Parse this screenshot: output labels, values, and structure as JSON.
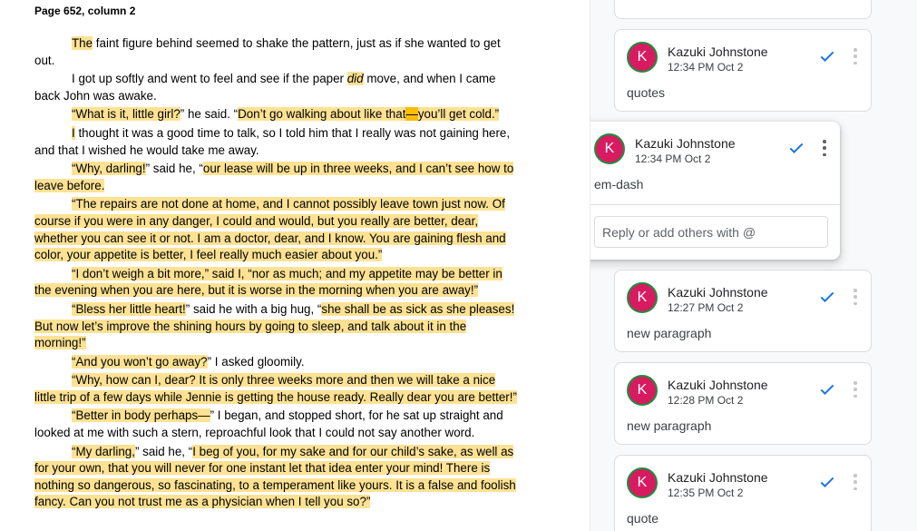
{
  "document": {
    "page_heading": "Page 652, column 2",
    "paragraphs": [
      {
        "segments": [
          {
            "text": "The",
            "style": "hl"
          },
          {
            "text": " faint figure behind seemed to shake the pattern, just as if she wanted to get out.",
            "style": ""
          }
        ]
      },
      {
        "segments": [
          {
            "text": "I got up softly and went to feel and see if the paper ",
            "style": ""
          },
          {
            "text": "did",
            "style": "hl-em"
          },
          {
            "text": " move, and when I came back John was awake.",
            "style": ""
          }
        ]
      },
      {
        "segments": [
          {
            "text": "“What is it, little girl?",
            "style": "hl"
          },
          {
            "text": "” he said. “",
            "style": ""
          },
          {
            "text": "Don’t go walking about like that",
            "style": "hl"
          },
          {
            "text": "—",
            "style": "hl-strong"
          },
          {
            "text": "you’ll get cold.”",
            "style": "hl"
          }
        ]
      },
      {
        "segments": [
          {
            "text": "I",
            "style": "hl"
          },
          {
            "text": " thought it was a good time to talk, so I told him that I really was not gaining here, and that I wished he would take me away.",
            "style": ""
          }
        ]
      },
      {
        "segments": [
          {
            "text": "“Why, darling!",
            "style": "hl"
          },
          {
            "text": "” said he, “",
            "style": ""
          },
          {
            "text": "our lease will be up in three weeks, and I can’t see how to leave before.",
            "style": "hl"
          }
        ]
      },
      {
        "segments": [
          {
            "text": "“The repairs are not done at home, and I cannot possibly leave town just now. Of course if you were in any danger, I could and would, but you really are better, dear, whether you can see it or not. I am a doctor, dear, and I know. You are gaining flesh and color, your appetite is better, I feel really much easier about you.”",
            "style": "hl"
          }
        ]
      },
      {
        "segments": [
          {
            "text": "“I don’t weigh a bit more,” said I, “nor as much; and my appetite may be better in the evening when you are here, but it is worse in the morning when you are away!”",
            "style": "hl"
          }
        ]
      },
      {
        "segments": [
          {
            "text": "“Bless her little heart!",
            "style": "hl"
          },
          {
            "text": "” said he with a big hug, “",
            "style": ""
          },
          {
            "text": "she shall be as sick as she pleases! But now let’s improve the shining hours by going to sleep, and talk about it in the morning!”",
            "style": "hl"
          }
        ]
      },
      {
        "segments": [
          {
            "text": "“And you won’t go away?",
            "style": "hl"
          },
          {
            "text": "” I asked gloomily.",
            "style": ""
          }
        ]
      },
      {
        "segments": [
          {
            "text": "“Why, how can I, dear? It is only three weeks more and then we will take a nice little trip of a few days while Jennie is getting the house ready. Really dear you are better!”",
            "style": "hl"
          }
        ]
      },
      {
        "segments": [
          {
            "text": "“Better in body perhaps—",
            "style": "hl"
          },
          {
            "text": "” I began, and stopped short, for he sat up straight and looked at me with such a stern, reproachful look that I could not say another word.",
            "style": ""
          }
        ]
      },
      {
        "segments": [
          {
            "text": "“My darling,",
            "style": "hl"
          },
          {
            "text": "” said he, “",
            "style": ""
          },
          {
            "text": "I beg of you, for my sake and for our child’s sake, as well as for your own, that you will never for one instant let that idea enter your mind! There is nothing so dangerous, so fascinating, to a temperament like yours. It is a false and foolish fancy. Can you not trust me as a physician when I tell you so?”",
            "style": "hl"
          }
        ]
      }
    ]
  },
  "comments": {
    "partial_top": {
      "text": "quotes"
    },
    "cards": [
      {
        "avatar_letter": "K",
        "author": "Kazuki Johnstone",
        "time": "12:34 PM Oct 2",
        "text": "quotes",
        "active": false
      },
      {
        "avatar_letter": "K",
        "author": "Kazuki Johnstone",
        "time": "12:34 PM Oct 2",
        "text": "em-dash",
        "active": true,
        "reply_placeholder": "Reply or add others with @"
      },
      {
        "avatar_letter": "K",
        "author": "Kazuki Johnstone",
        "time": "12:27 PM Oct 2",
        "text": "new paragraph",
        "active": false
      },
      {
        "avatar_letter": "K",
        "author": "Kazuki Johnstone",
        "time": "12:28 PM Oct 2",
        "text": "new paragraph",
        "active": false
      },
      {
        "avatar_letter": "K",
        "author": "Kazuki Johnstone",
        "time": "12:35 PM Oct 2",
        "text": "quote",
        "active": false
      }
    ]
  },
  "colors": {
    "highlight": "#fde293",
    "highlight_strong": "#fbbc04",
    "avatar_bg": "#d81b60",
    "avatar_ring": "#1e8e3e",
    "resolve_check": "#1a73e8"
  },
  "icons": {
    "resolve": "checkmark-icon",
    "more": "more-vert-icon"
  }
}
